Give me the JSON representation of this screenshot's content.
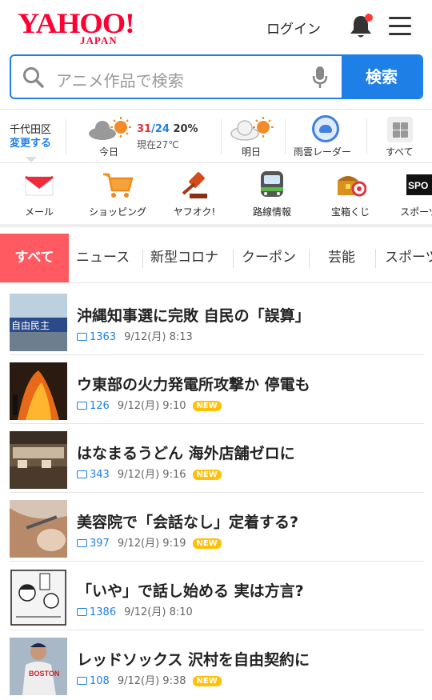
{
  "header": {
    "logo_text": "YAHOO!",
    "logo_sub": "JAPAN",
    "login_label": "ログイン",
    "notification_dot_color": "#ff3b30"
  },
  "search": {
    "placeholder": "アニメ作品で検索",
    "button_label": "検索"
  },
  "weather": {
    "location": "千代田区",
    "change_label": "変更する",
    "today_label": "今日",
    "high": "31",
    "low": "24",
    "precip": "20%",
    "now_label": "現在27℃",
    "tomorrow_label": "明日",
    "radar_label": "雨雲レーダー",
    "all_label": "すべて"
  },
  "services": [
    {
      "label": "メール",
      "icon": "mail-icon"
    },
    {
      "label": "ショッピング",
      "icon": "shopping-cart-icon"
    },
    {
      "label": "ヤフオク!",
      "icon": "auction-gavel-icon"
    },
    {
      "label": "路線情報",
      "icon": "train-icon"
    },
    {
      "label": "宝箱くじ",
      "icon": "treasure-box-icon"
    },
    {
      "label": "スポーツ",
      "icon": "sports-icon"
    }
  ],
  "tabs": [
    "すべて",
    "ニュース",
    "新型コロナ",
    "クーポン",
    "芸能",
    "スポーツ"
  ],
  "news": [
    {
      "title": "沖縄知事選に完敗 自民の「誤算」",
      "comments": "1363",
      "date": "9/12(月) 8:13",
      "is_new": false
    },
    {
      "title": "ウ東部の火力発電所攻撃か 停電も",
      "comments": "126",
      "date": "9/12(月) 9:10",
      "is_new": true
    },
    {
      "title": "はなまるうどん 海外店舗ゼロに",
      "comments": "343",
      "date": "9/12(月) 9:16",
      "is_new": true
    },
    {
      "title": "美容院で「会話なし」定着する?",
      "comments": "397",
      "date": "9/12(月) 9:19",
      "is_new": true
    },
    {
      "title": "「いや」で話し始める 実は方言?",
      "comments": "1386",
      "date": "9/12(月) 8:10",
      "is_new": false
    },
    {
      "title": "レッドソックス 沢村を自由契約に",
      "comments": "108",
      "date": "9/12(月) 9:38",
      "is_new": true
    }
  ],
  "new_badge_label": "NEW"
}
